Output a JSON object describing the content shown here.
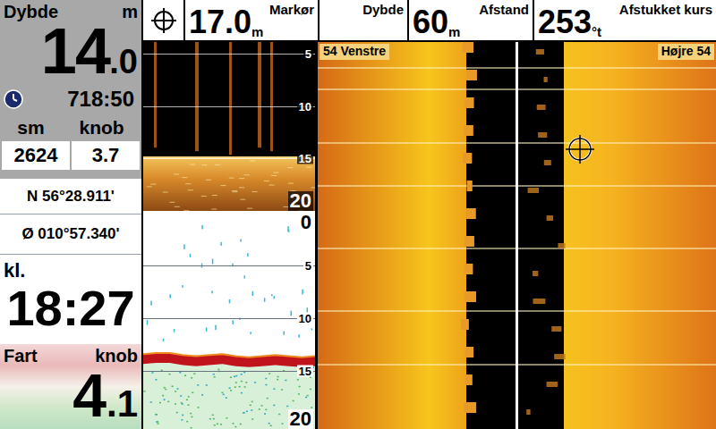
{
  "left_panel": {
    "depth": {
      "label": "Dybde",
      "unit": "m",
      "whole": "14",
      "decimal": ".0"
    },
    "timer": {
      "value": "718:50"
    },
    "trip": {
      "labels": [
        "sm",
        "knob"
      ],
      "values": [
        "2624",
        "3.7"
      ]
    },
    "position": {
      "lat": "N 56°28.911'",
      "lon": "Ø 010°57.340'"
    },
    "clock": {
      "label": "kl.",
      "value": "18:27"
    },
    "speed": {
      "label": "Fart",
      "unit": "knob",
      "whole": "4",
      "decimal": ".1"
    }
  },
  "top_bar": {
    "cells": [
      {
        "label": "Markør",
        "value": "17.0",
        "unit": "m"
      },
      {
        "label": "Dybde",
        "value": "",
        "unit": ""
      },
      {
        "label": "Afstand",
        "value": "60",
        "unit": "m"
      },
      {
        "label": "Afstukket kurs",
        "value": "253",
        "unit": "°t"
      }
    ]
  },
  "down_imaging": {
    "depth_scale": [
      "5",
      "10",
      "15",
      "20"
    ],
    "bottom_depth_m": 14.6
  },
  "sonar_2d": {
    "depth_scale": [
      "0",
      "5",
      "10",
      "15",
      "20"
    ],
    "bottom_depth_m": [
      13.4,
      13.3,
      13.3,
      13.5,
      13.6,
      13.5,
      13.4,
      13.6,
      13.7,
      13.6,
      13.5,
      13.6,
      13.7,
      13.6
    ]
  },
  "side_imaging": {
    "left_label": "54 Venstre",
    "right_label": "Højre 54"
  }
}
